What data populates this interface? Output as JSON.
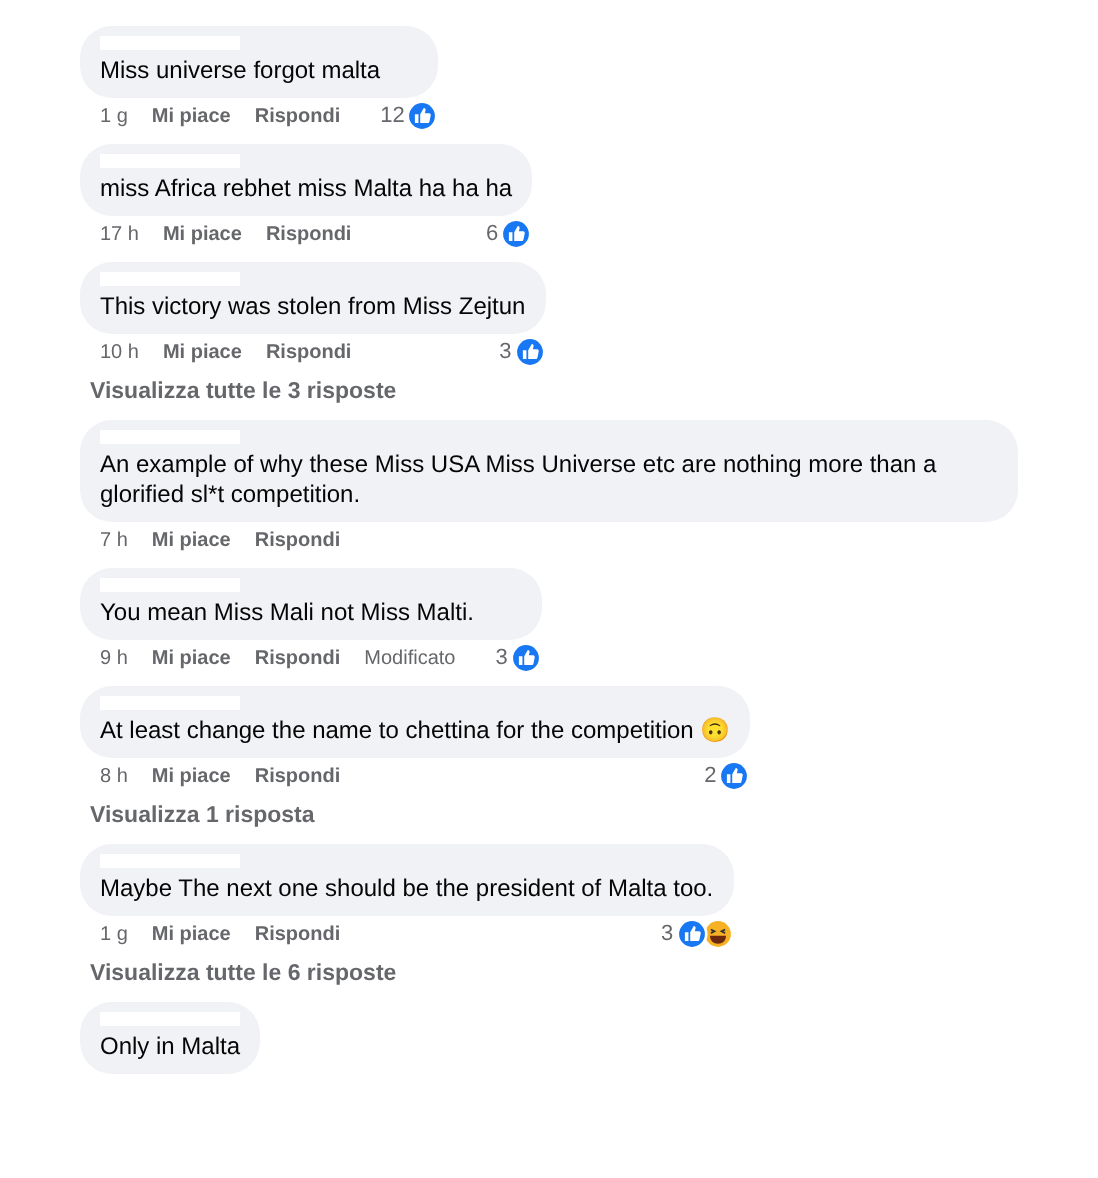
{
  "items": [
    {
      "kind": "comment",
      "text": "Miss universe forgot malta",
      "time": "1 g",
      "like": "Mi piace",
      "reply": "Rispondi",
      "count": "12",
      "reactions": [
        {
          "kind": "like"
        }
      ]
    },
    {
      "kind": "comment",
      "text": "miss Africa rebhet miss Malta ha ha ha",
      "time": "17 h",
      "like": "Mi piace",
      "reply": "Rispondi",
      "count": "6",
      "reactions": [
        {
          "kind": "like"
        }
      ]
    },
    {
      "kind": "comment",
      "text": "This victory was stolen from Miss Zejtun",
      "time": "10 h",
      "like": "Mi piace",
      "reply": "Rispondi",
      "count": "3",
      "reactions": [
        {
          "kind": "like"
        }
      ]
    },
    {
      "kind": "more_replies",
      "text": "Visualizza tutte le 3 risposte"
    },
    {
      "kind": "comment",
      "text": "An example of why these Miss USA Miss Universe etc are nothing more than a glorified sl*t competition.",
      "time": "7 h",
      "like": "Mi piace",
      "reply": "Rispondi"
    },
    {
      "kind": "comment",
      "text": "You mean Miss Mali not Miss Malti.",
      "time": "9 h",
      "like": "Mi piace",
      "reply": "Rispondi",
      "edited": "Modificato",
      "count": "3",
      "reactions": [
        {
          "kind": "like"
        }
      ]
    },
    {
      "kind": "comment",
      "text": "At least change the name to chettina for the competition 🙃",
      "time": "8 h",
      "like": "Mi piace",
      "reply": "Rispondi",
      "count": "2",
      "reactions": [
        {
          "kind": "like"
        }
      ]
    },
    {
      "kind": "more_replies",
      "text": "Visualizza 1 risposta"
    },
    {
      "kind": "comment",
      "text": "Maybe The next one should be the president of Malta too.",
      "time": "1 g",
      "like": "Mi piace",
      "reply": "Rispondi",
      "count": "3",
      "reactions": [
        {
          "kind": "like"
        },
        {
          "kind": "haha"
        }
      ]
    },
    {
      "kind": "more_replies",
      "text": "Visualizza tutte le 6 risposte"
    },
    {
      "kind": "comment",
      "text": "Only in Malta"
    }
  ]
}
